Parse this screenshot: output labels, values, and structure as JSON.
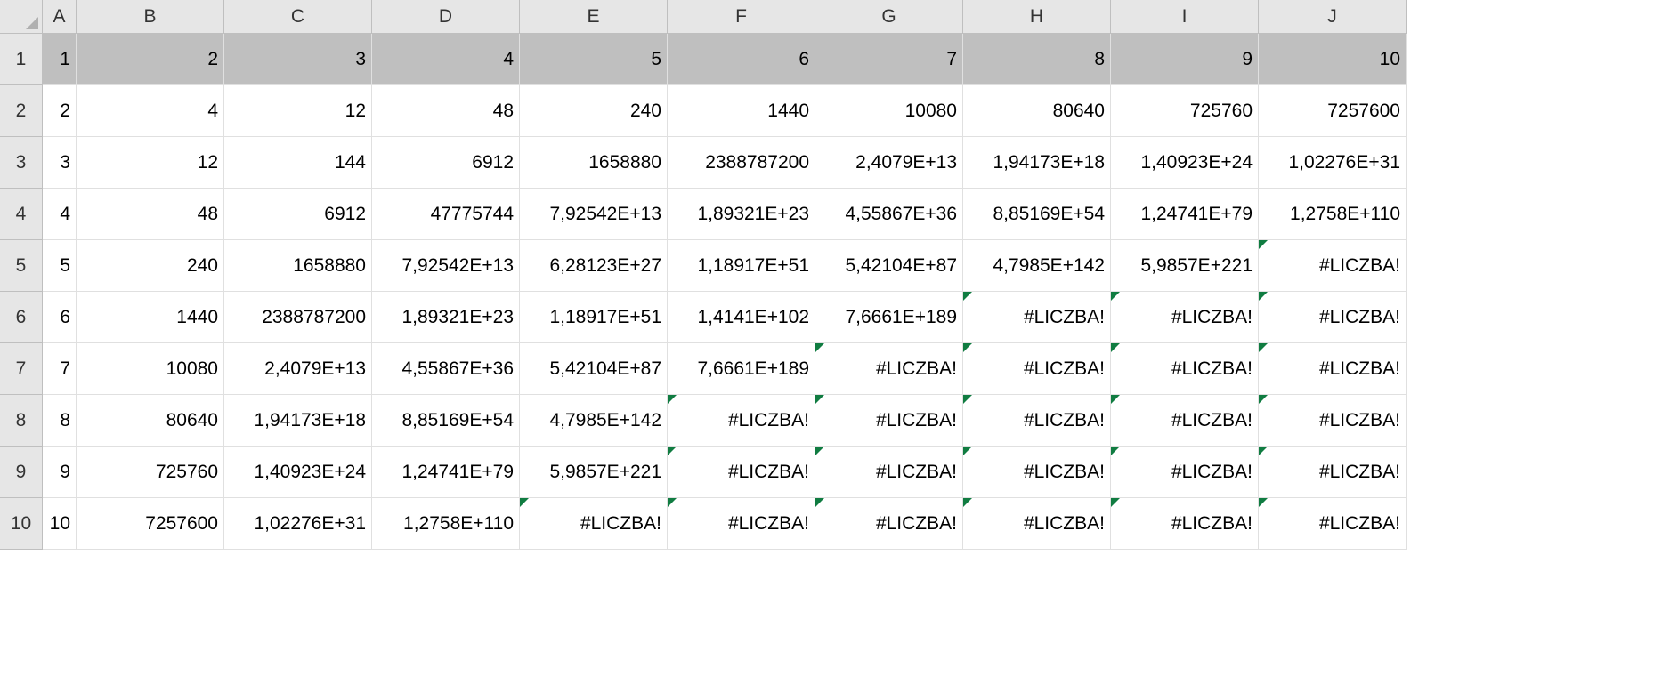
{
  "columns": [
    "A",
    "B",
    "C",
    "D",
    "E",
    "F",
    "G",
    "H",
    "I",
    "J"
  ],
  "rowNumbers": [
    "1",
    "2",
    "3",
    "4",
    "5",
    "6",
    "7",
    "8",
    "9",
    "10"
  ],
  "rows": [
    {
      "selected": true,
      "cells": [
        {
          "v": "1"
        },
        {
          "v": "2"
        },
        {
          "v": "3"
        },
        {
          "v": "4"
        },
        {
          "v": "5"
        },
        {
          "v": "6"
        },
        {
          "v": "7"
        },
        {
          "v": "8"
        },
        {
          "v": "9"
        },
        {
          "v": "10"
        }
      ]
    },
    {
      "cells": [
        {
          "v": "2"
        },
        {
          "v": "4"
        },
        {
          "v": "12"
        },
        {
          "v": "48"
        },
        {
          "v": "240"
        },
        {
          "v": "1440"
        },
        {
          "v": "10080"
        },
        {
          "v": "80640"
        },
        {
          "v": "725760"
        },
        {
          "v": "7257600"
        }
      ]
    },
    {
      "cells": [
        {
          "v": "3"
        },
        {
          "v": "12"
        },
        {
          "v": "144"
        },
        {
          "v": "6912"
        },
        {
          "v": "1658880"
        },
        {
          "v": "2388787200"
        },
        {
          "v": "2,4079E+13"
        },
        {
          "v": "1,94173E+18"
        },
        {
          "v": "1,40923E+24"
        },
        {
          "v": "1,02276E+31"
        }
      ]
    },
    {
      "cells": [
        {
          "v": "4"
        },
        {
          "v": "48"
        },
        {
          "v": "6912"
        },
        {
          "v": "47775744"
        },
        {
          "v": "7,92542E+13"
        },
        {
          "v": "1,89321E+23"
        },
        {
          "v": "4,55867E+36"
        },
        {
          "v": "8,85169E+54"
        },
        {
          "v": "1,24741E+79"
        },
        {
          "v": "1,2758E+110"
        }
      ]
    },
    {
      "cells": [
        {
          "v": "5"
        },
        {
          "v": "240"
        },
        {
          "v": "1658880"
        },
        {
          "v": "7,92542E+13"
        },
        {
          "v": "6,28123E+27"
        },
        {
          "v": "1,18917E+51"
        },
        {
          "v": "5,42104E+87"
        },
        {
          "v": "4,7985E+142"
        },
        {
          "v": "5,9857E+221"
        },
        {
          "v": "#LICZBA!",
          "err": true
        }
      ]
    },
    {
      "cells": [
        {
          "v": "6"
        },
        {
          "v": "1440"
        },
        {
          "v": "2388787200"
        },
        {
          "v": "1,89321E+23"
        },
        {
          "v": "1,18917E+51"
        },
        {
          "v": "1,4141E+102"
        },
        {
          "v": "7,6661E+189"
        },
        {
          "v": "#LICZBA!",
          "err": true
        },
        {
          "v": "#LICZBA!",
          "err": true
        },
        {
          "v": "#LICZBA!",
          "err": true
        }
      ]
    },
    {
      "cells": [
        {
          "v": "7"
        },
        {
          "v": "10080"
        },
        {
          "v": "2,4079E+13"
        },
        {
          "v": "4,55867E+36"
        },
        {
          "v": "5,42104E+87"
        },
        {
          "v": "7,6661E+189"
        },
        {
          "v": "#LICZBA!",
          "err": true
        },
        {
          "v": "#LICZBA!",
          "err": true
        },
        {
          "v": "#LICZBA!",
          "err": true
        },
        {
          "v": "#LICZBA!",
          "err": true
        }
      ]
    },
    {
      "cells": [
        {
          "v": "8"
        },
        {
          "v": "80640"
        },
        {
          "v": "1,94173E+18"
        },
        {
          "v": "8,85169E+54"
        },
        {
          "v": "4,7985E+142"
        },
        {
          "v": "#LICZBA!",
          "err": true
        },
        {
          "v": "#LICZBA!",
          "err": true
        },
        {
          "v": "#LICZBA!",
          "err": true
        },
        {
          "v": "#LICZBA!",
          "err": true
        },
        {
          "v": "#LICZBA!",
          "err": true
        }
      ]
    },
    {
      "cells": [
        {
          "v": "9"
        },
        {
          "v": "725760"
        },
        {
          "v": "1,40923E+24"
        },
        {
          "v": "1,24741E+79"
        },
        {
          "v": "5,9857E+221"
        },
        {
          "v": "#LICZBA!",
          "err": true
        },
        {
          "v": "#LICZBA!",
          "err": true
        },
        {
          "v": "#LICZBA!",
          "err": true
        },
        {
          "v": "#LICZBA!",
          "err": true
        },
        {
          "v": "#LICZBA!",
          "err": true
        }
      ]
    },
    {
      "cells": [
        {
          "v": "10"
        },
        {
          "v": "7257600"
        },
        {
          "v": "1,02276E+31"
        },
        {
          "v": "1,2758E+110"
        },
        {
          "v": "#LICZBA!",
          "err": true
        },
        {
          "v": "#LICZBA!",
          "err": true
        },
        {
          "v": "#LICZBA!",
          "err": true
        },
        {
          "v": "#LICZBA!",
          "err": true
        },
        {
          "v": "#LICZBA!",
          "err": true
        },
        {
          "v": "#LICZBA!",
          "err": true
        }
      ]
    }
  ]
}
